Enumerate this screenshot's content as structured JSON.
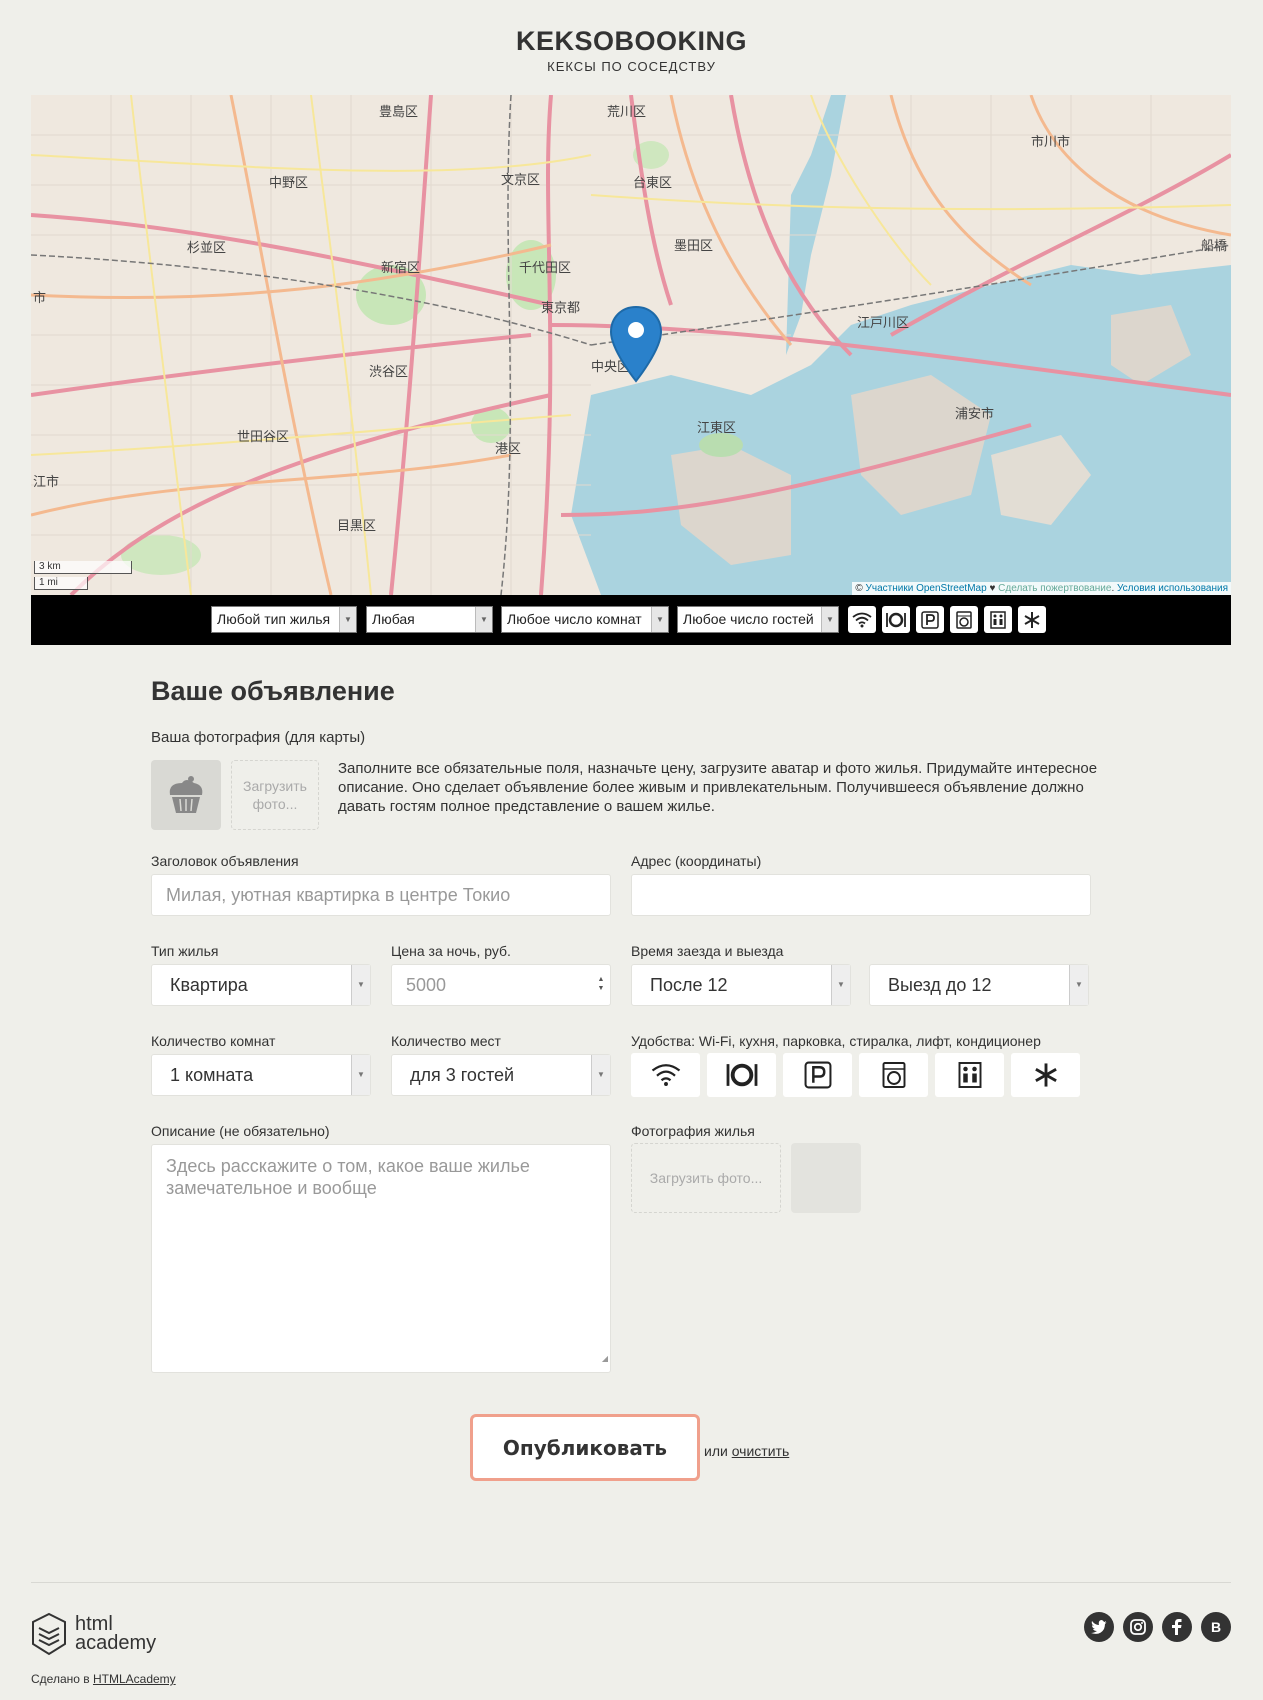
{
  "header": {
    "logo": "KEKSOBOOKING",
    "tagline": "КЕКСЫ ПО СОСЕДСТВУ"
  },
  "map": {
    "labels": [
      "豊島区",
      "荒川区",
      "中野区",
      "文京区",
      "台東区",
      "市川市",
      "杉並区",
      "新宿区",
      "千代田区",
      "墨田区",
      "東京都",
      "江戸川区",
      "渋谷区",
      "中央区",
      "浦安市",
      "世田谷区",
      "江東区",
      "港区",
      "目黒区",
      "市",
      "江市",
      "船橋"
    ],
    "scale_km": "3 km",
    "scale_mi": "1 mi",
    "attribution": {
      "prefix": "©",
      "osm": "Участники OpenStreetMap",
      "heart": "♥",
      "donate": "Сделать пожертвование",
      "sep": ".",
      "terms": "Условия использования"
    }
  },
  "filters": {
    "type": "Любой тип жилья",
    "price": "Любая",
    "rooms": "Любое число комнат",
    "guests": "Любое число гостей",
    "features": [
      "wifi-icon",
      "dishwasher-icon",
      "parking-icon",
      "washer-icon",
      "elevator-icon",
      "conditioner-icon"
    ]
  },
  "form": {
    "title": "Ваше объявление",
    "avatar_label": "Ваша фотография (для карты)",
    "avatar_upload": "Загрузить фото...",
    "intro": "Заполните все обязательные поля, назначьте цену, загрузите аватар и фото жилья. Придумайте интересное описание. Оно сделает объявление более живым и привлекательным. Получившееся объявление должно давать гостям полное представление о вашем жилье.",
    "title_label": "Заголовок объявления",
    "title_placeholder": "Милая, уютная квартирка в центре Токио",
    "address_label": "Адрес (координаты)",
    "address_value": "",
    "type_label": "Тип жилья",
    "type_value": "Квартира",
    "price_label": "Цена за ночь, руб.",
    "price_placeholder": "5000",
    "time_label": "Время заезда и выезда",
    "timein_value": "После 12",
    "timeout_value": "Выезд до 12",
    "rooms_label": "Количество комнат",
    "rooms_value": "1 комната",
    "capacity_label": "Количество мест",
    "capacity_value": "для 3 гостей",
    "features_label": "Удобства: Wi-Fi, кухня, парковка, стиралка, лифт, кондиционер",
    "description_label": "Описание (не обязательно)",
    "description_placeholder": "Здесь расскажите о том, какое ваше жилье замечательное и вообще",
    "photos_label": "Фотография жилья",
    "photos_upload": "Загрузить фото...",
    "submit": "Опубликовать",
    "or": "или",
    "reset": "очистить"
  },
  "footer": {
    "brand_line1": "html",
    "brand_line2": "academy",
    "made_in": "Сделано в",
    "made_in_link": "HTMLAcademy",
    "social": [
      "twitter-icon",
      "instagram-icon",
      "facebook-icon",
      "vk-icon"
    ],
    "vk_letter": "B"
  },
  "colors": {
    "background": "#efefea",
    "filters_bar": "#000000",
    "publish_border": "#f0a08c",
    "pin": "#2a81cb",
    "water": "#aad3df"
  }
}
